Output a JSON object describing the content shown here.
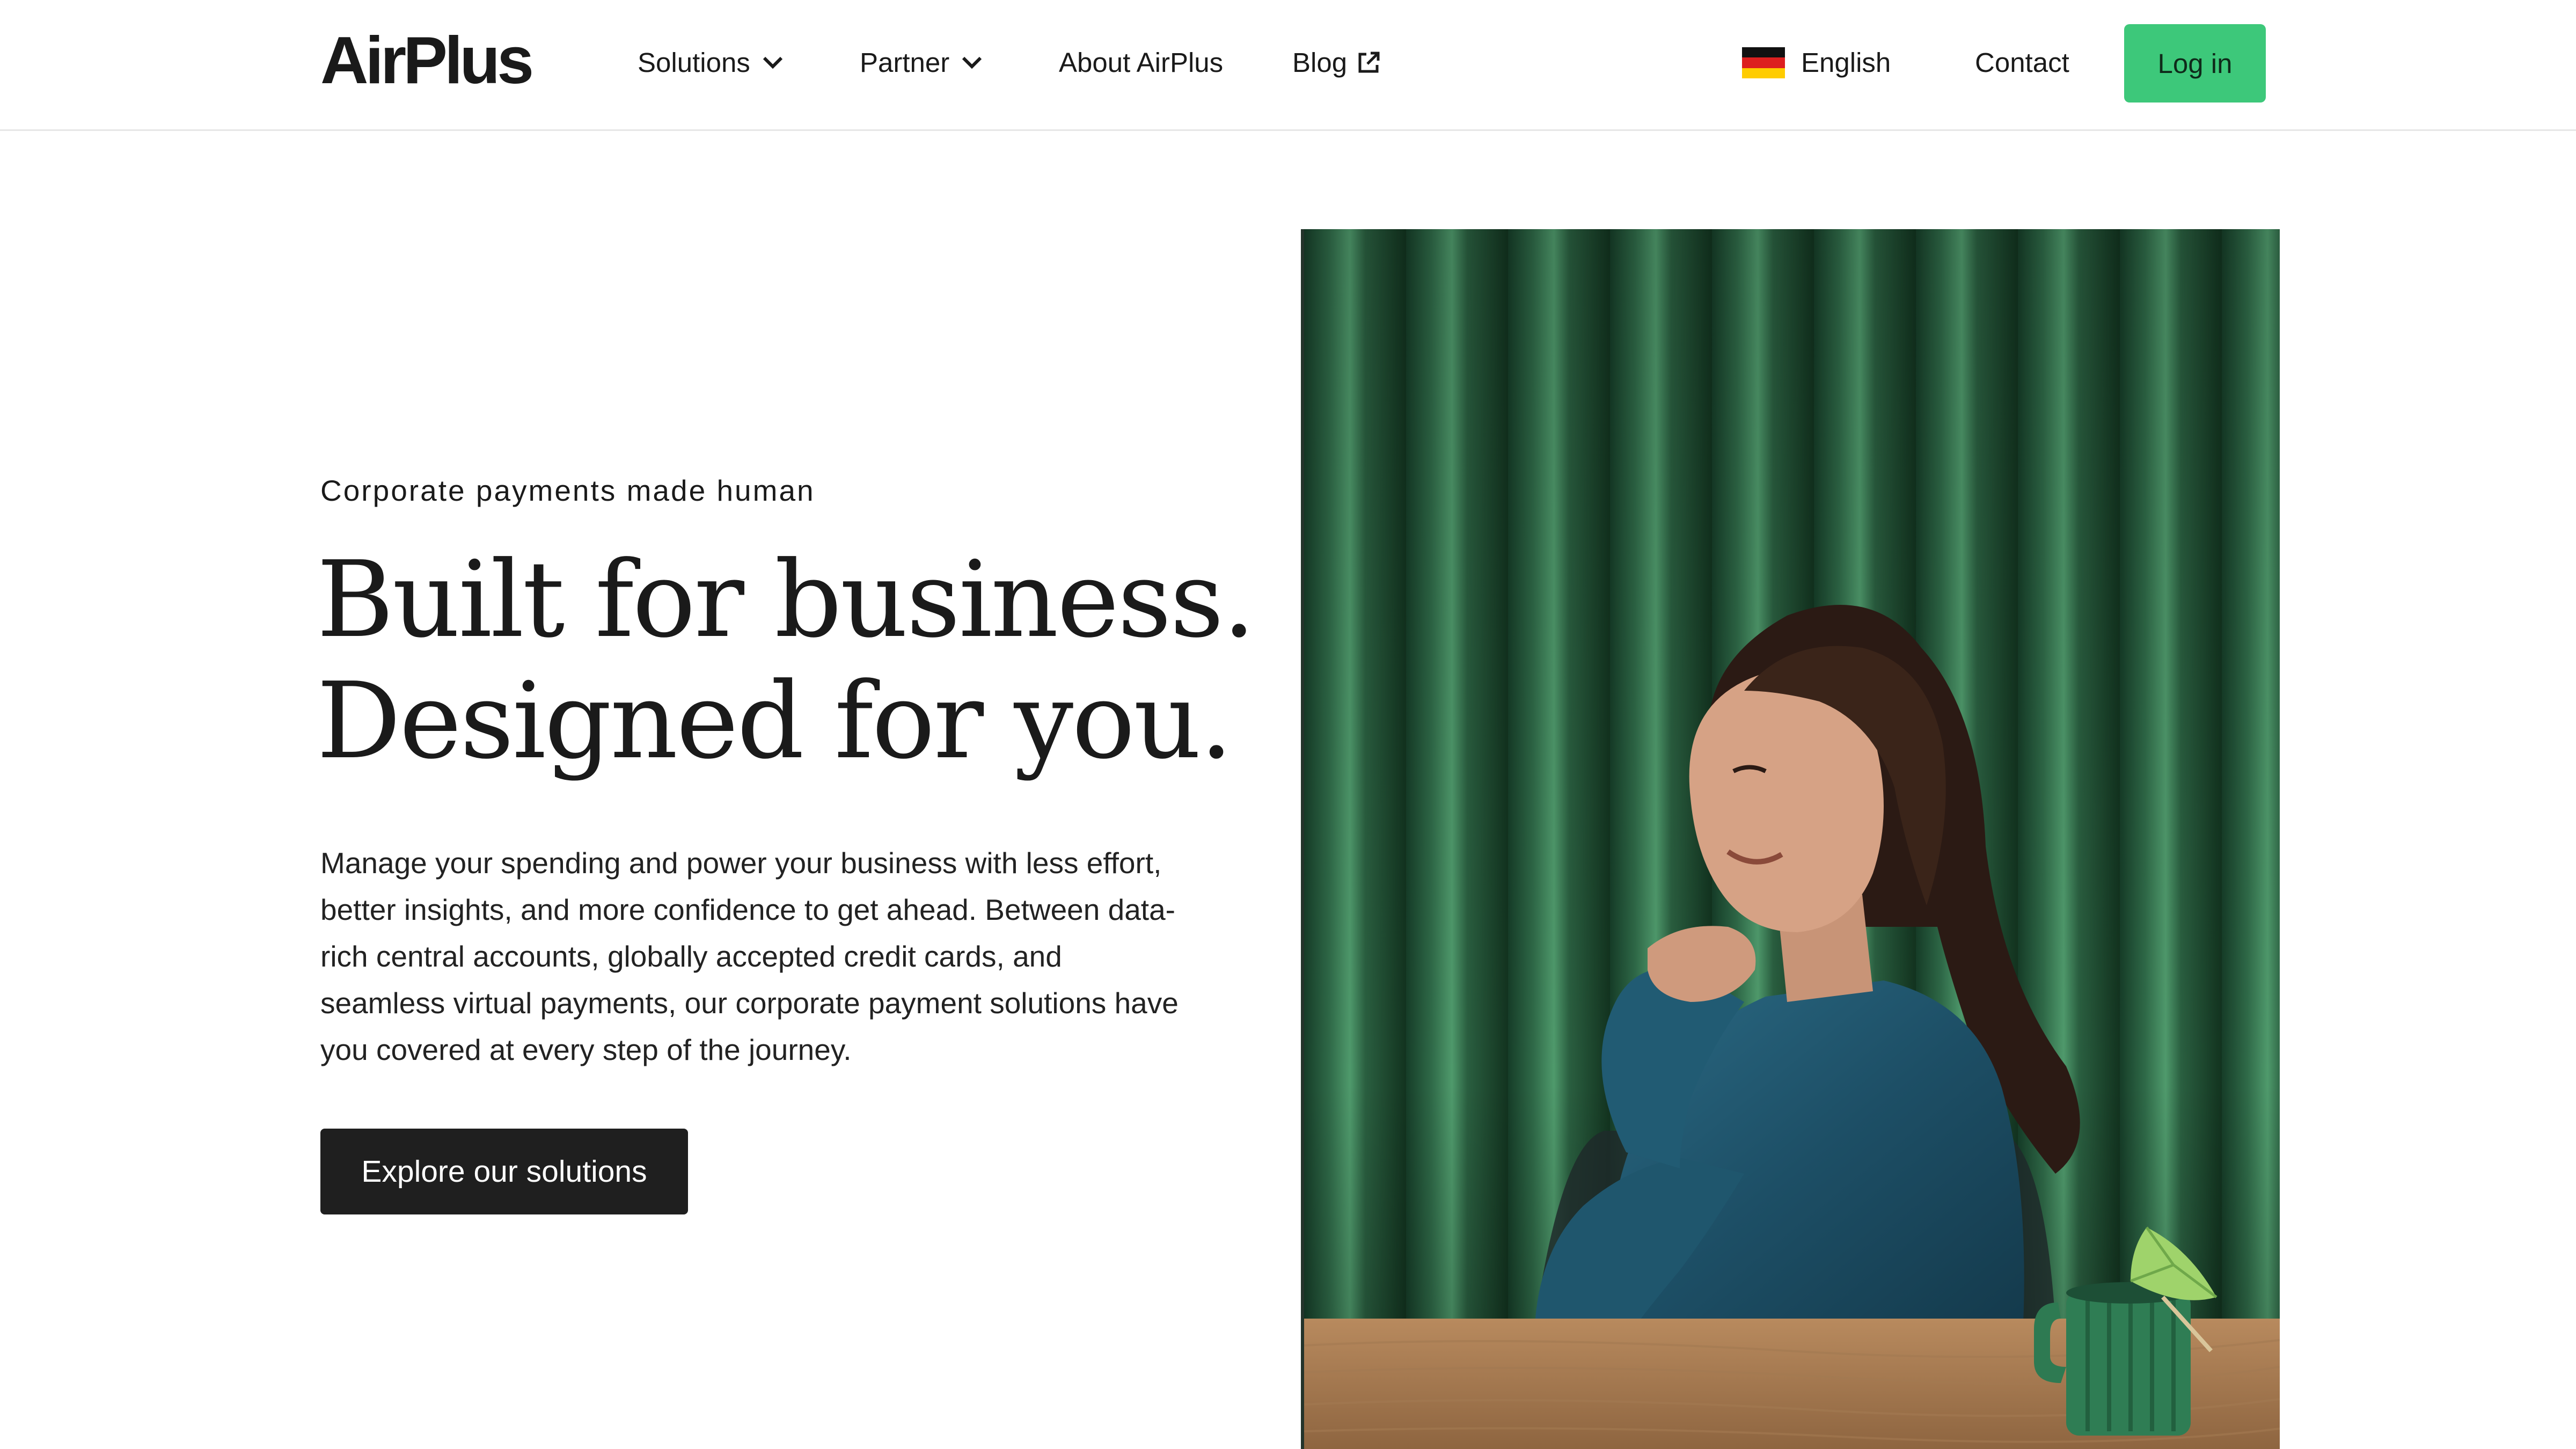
{
  "header": {
    "logo": "AirPlus",
    "nav": {
      "solutions": "Solutions",
      "partner": "Partner",
      "about": "About AirPlus",
      "blog": "Blog"
    },
    "language": "English",
    "contact": "Contact",
    "login": "Log in"
  },
  "hero": {
    "eyebrow": "Corporate payments made human",
    "headline_line1": "Built for business.",
    "headline_line2": "Designed for you.",
    "body": "Manage your spending and power your business with less effort, better insights, and more confidence to get ahead. Between data-rich central accounts, globally accepted credit cards, and seamless virtual payments, our corporate payment solutions have you covered at every step of the journey.",
    "cta": "Explore our solutions"
  },
  "colors": {
    "accent_green": "#3dc87a",
    "cta_dark": "#1f1f1f",
    "curtain_green": "#2f6a48"
  },
  "icons": {
    "solutions_chevron": "chevron-down-icon",
    "partner_chevron": "chevron-down-icon",
    "blog_external": "external-link-icon",
    "language_flag": "germany-flag-icon"
  }
}
